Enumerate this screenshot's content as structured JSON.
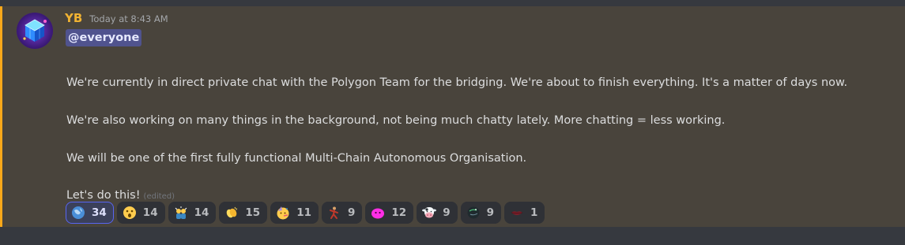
{
  "message": {
    "username": "YB",
    "timestamp": "Today at 8:43 AM",
    "mention": "@everyone",
    "lines": [
      "We're currently in direct private chat with the Polygon Team for the bridging. We're about to finish everything. It's a matter of days now.",
      "We're also working on many things in the background, not being much chatty lately. More chatting = less working.",
      "We will be one of the first fully functional Multi-Chain Autonomous Organisation.",
      "Let's do this!"
    ],
    "edited_label": "(edited)",
    "highlight_color": "#faa81a"
  },
  "reactions": [
    {
      "icon": "globe-emoji",
      "count": "34",
      "active": true
    },
    {
      "icon": "astonished-face-emoji",
      "count": "14"
    },
    {
      "icon": "party-popper-people-emoji",
      "count": "14"
    },
    {
      "icon": "clapping-hands-emoji",
      "count": "15"
    },
    {
      "icon": "partying-face-emoji",
      "count": "11"
    },
    {
      "icon": "dancing-figure-emoji",
      "count": "9"
    },
    {
      "icon": "pink-blob-emoji",
      "count": "12"
    },
    {
      "icon": "cow-face-emoji",
      "count": "9"
    },
    {
      "icon": "dark-orb-emoji",
      "count": "9"
    },
    {
      "icon": "red-lips-emoji",
      "count": "1"
    }
  ]
}
